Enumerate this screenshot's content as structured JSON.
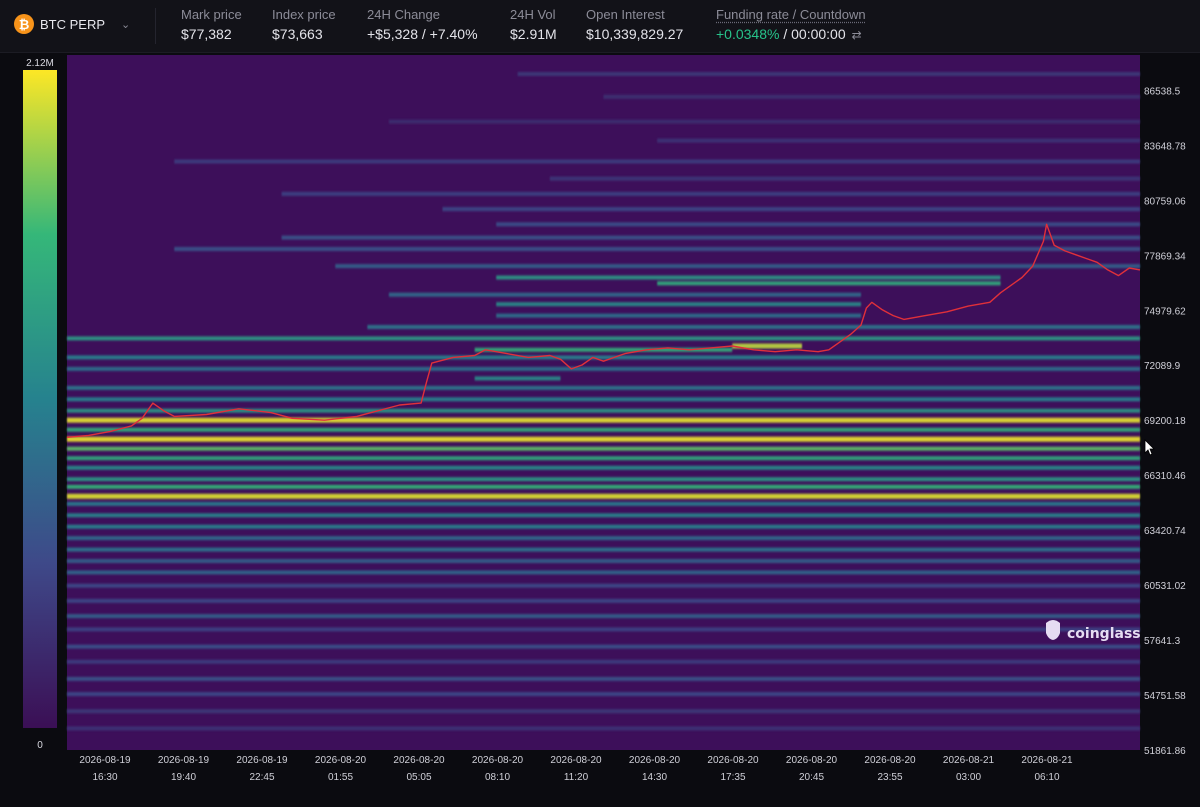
{
  "header": {
    "symbol": "BTC PERP",
    "icon": "bitcoin-icon",
    "stats": [
      {
        "key": "mark",
        "label": "Mark price",
        "value": "$77,382"
      },
      {
        "key": "index",
        "label": "Index price",
        "value": "$73,663"
      },
      {
        "key": "change",
        "label": "24H Change",
        "value": "+$5,328 / +7.40%",
        "color": "#27c28a"
      },
      {
        "key": "vol",
        "label": "24H Vol",
        "value": "$2.91M"
      },
      {
        "key": "oi",
        "label": "Open Interest",
        "value": "$10,339,829.27"
      },
      {
        "key": "funding",
        "label": "Funding rate / Countdown",
        "value_rate": "+0.0348%",
        "value_countdown": " / 00:00:00"
      }
    ]
  },
  "brand": "coinglass",
  "chart_data": {
    "type": "heatmap",
    "title": "",
    "colorbar": {
      "max_label": "2.12M",
      "min_label": "0",
      "colors": [
        "#3b0f55",
        "#3e4989",
        "#26828e",
        "#35b779",
        "#fde725"
      ]
    },
    "y_ticks": [
      "86538.5",
      "83648.78",
      "80759.06",
      "77869.34",
      "74979.62",
      "72089.9",
      "69200.18",
      "66310.46",
      "63420.74",
      "60531.02",
      "57641.3",
      "54751.58",
      "51861.86"
    ],
    "ylim": [
      51861.86,
      88400
    ],
    "x_ticks": [
      {
        "date": "2026-08-19",
        "time": "16:30"
      },
      {
        "date": "2026-08-19",
        "time": "19:40"
      },
      {
        "date": "2026-08-19",
        "time": "22:45"
      },
      {
        "date": "2026-08-20",
        "time": "01:55"
      },
      {
        "date": "2026-08-20",
        "time": "05:05"
      },
      {
        "date": "2026-08-20",
        "time": "08:10"
      },
      {
        "date": "2026-08-20",
        "time": "11:20"
      },
      {
        "date": "2026-08-20",
        "time": "14:30"
      },
      {
        "date": "2026-08-20",
        "time": "17:35"
      },
      {
        "date": "2026-08-20",
        "time": "20:45"
      },
      {
        "date": "2026-08-20",
        "time": "23:55"
      },
      {
        "date": "2026-08-21",
        "time": "03:00"
      },
      {
        "date": "2026-08-21",
        "time": "06:10"
      }
    ],
    "liquidation_levels": [
      {
        "price": 87400,
        "intensity": 0.18,
        "start": 0.42
      },
      {
        "price": 86200,
        "intensity": 0.14,
        "start": 0.5
      },
      {
        "price": 84900,
        "intensity": 0.13,
        "start": 0.3
      },
      {
        "price": 83900,
        "intensity": 0.16,
        "start": 0.55
      },
      {
        "price": 82800,
        "intensity": 0.2,
        "start": 0.1
      },
      {
        "price": 81900,
        "intensity": 0.17,
        "start": 0.45
      },
      {
        "price": 81100,
        "intensity": 0.22,
        "start": 0.2
      },
      {
        "price": 80300,
        "intensity": 0.24,
        "start": 0.35
      },
      {
        "price": 79500,
        "intensity": 0.28,
        "start": 0.4
      },
      {
        "price": 78800,
        "intensity": 0.3,
        "start": 0.2
      },
      {
        "price": 78200,
        "intensity": 0.3,
        "start": 0.1
      },
      {
        "price": 77300,
        "intensity": 0.36,
        "start": 0.25
      },
      {
        "price": 76700,
        "intensity": 0.6,
        "start": 0.4,
        "end": 0.87
      },
      {
        "price": 76400,
        "intensity": 0.7,
        "start": 0.55,
        "end": 0.87
      },
      {
        "price": 75800,
        "intensity": 0.4,
        "start": 0.3,
        "end": 0.74
      },
      {
        "price": 75300,
        "intensity": 0.55,
        "start": 0.4,
        "end": 0.74
      },
      {
        "price": 74700,
        "intensity": 0.42,
        "start": 0.4,
        "end": 0.74
      },
      {
        "price": 74100,
        "intensity": 0.45,
        "start": 0.28
      },
      {
        "price": 73500,
        "intensity": 0.62,
        "start": 0.0
      },
      {
        "price": 73100,
        "intensity": 0.92,
        "start": 0.62,
        "end": 0.685
      },
      {
        "price": 72900,
        "intensity": 0.72,
        "start": 0.38,
        "end": 0.62
      },
      {
        "price": 72500,
        "intensity": 0.5,
        "start": 0.0
      },
      {
        "price": 71900,
        "intensity": 0.42,
        "start": 0.0
      },
      {
        "price": 71400,
        "intensity": 0.55,
        "start": 0.38,
        "end": 0.46
      },
      {
        "price": 70900,
        "intensity": 0.45,
        "start": 0.0
      },
      {
        "price": 70300,
        "intensity": 0.5,
        "start": 0.0
      },
      {
        "price": 69700,
        "intensity": 0.6,
        "start": 0.0
      },
      {
        "price": 69200,
        "intensity": 0.97,
        "start": 0.0
      },
      {
        "price": 68700,
        "intensity": 0.72,
        "start": 0.0
      },
      {
        "price": 68200,
        "intensity": 0.98,
        "start": 0.0
      },
      {
        "price": 67700,
        "intensity": 0.8,
        "start": 0.0
      },
      {
        "price": 67200,
        "intensity": 0.7,
        "start": 0.0
      },
      {
        "price": 66700,
        "intensity": 0.55,
        "start": 0.0
      },
      {
        "price": 66100,
        "intensity": 0.62,
        "start": 0.0
      },
      {
        "price": 65700,
        "intensity": 0.75,
        "start": 0.0
      },
      {
        "price": 65200,
        "intensity": 0.96,
        "start": 0.0
      },
      {
        "price": 64800,
        "intensity": 0.48,
        "start": 0.0
      },
      {
        "price": 64200,
        "intensity": 0.52,
        "start": 0.0
      },
      {
        "price": 63600,
        "intensity": 0.5,
        "start": 0.0
      },
      {
        "price": 63000,
        "intensity": 0.4,
        "start": 0.0
      },
      {
        "price": 62400,
        "intensity": 0.44,
        "start": 0.0
      },
      {
        "price": 61800,
        "intensity": 0.36,
        "start": 0.0
      },
      {
        "price": 61200,
        "intensity": 0.38,
        "start": 0.0
      },
      {
        "price": 60500,
        "intensity": 0.26,
        "start": 0.0
      },
      {
        "price": 59700,
        "intensity": 0.24,
        "start": 0.0
      },
      {
        "price": 58900,
        "intensity": 0.36,
        "start": 0.0
      },
      {
        "price": 58200,
        "intensity": 0.22,
        "start": 0.0
      },
      {
        "price": 57300,
        "intensity": 0.28,
        "start": 0.0
      },
      {
        "price": 56500,
        "intensity": 0.2,
        "start": 0.0
      },
      {
        "price": 55600,
        "intensity": 0.3,
        "start": 0.0
      },
      {
        "price": 54800,
        "intensity": 0.26,
        "start": 0.0
      },
      {
        "price": 53900,
        "intensity": 0.18,
        "start": 0.0
      },
      {
        "price": 53000,
        "intensity": 0.16,
        "start": 0.0
      }
    ],
    "price_series": [
      [
        0.0,
        68300
      ],
      [
        0.02,
        68400
      ],
      [
        0.04,
        68600
      ],
      [
        0.06,
        68900
      ],
      [
        0.07,
        69300
      ],
      [
        0.08,
        70100
      ],
      [
        0.09,
        69700
      ],
      [
        0.1,
        69400
      ],
      [
        0.13,
        69500
      ],
      [
        0.16,
        69800
      ],
      [
        0.19,
        69600
      ],
      [
        0.21,
        69300
      ],
      [
        0.24,
        69200
      ],
      [
        0.27,
        69400
      ],
      [
        0.29,
        69700
      ],
      [
        0.31,
        70000
      ],
      [
        0.33,
        70100
      ],
      [
        0.335,
        71200
      ],
      [
        0.34,
        72200
      ],
      [
        0.36,
        72500
      ],
      [
        0.38,
        72600
      ],
      [
        0.39,
        72900
      ],
      [
        0.41,
        72700
      ],
      [
        0.43,
        72500
      ],
      [
        0.45,
        72600
      ],
      [
        0.46,
        72400
      ],
      [
        0.47,
        71900
      ],
      [
        0.48,
        72100
      ],
      [
        0.49,
        72500
      ],
      [
        0.5,
        72300
      ],
      [
        0.51,
        72500
      ],
      [
        0.52,
        72700
      ],
      [
        0.54,
        72900
      ],
      [
        0.56,
        73000
      ],
      [
        0.58,
        72900
      ],
      [
        0.6,
        73000
      ],
      [
        0.62,
        73100
      ],
      [
        0.64,
        72900
      ],
      [
        0.66,
        72800
      ],
      [
        0.68,
        72900
      ],
      [
        0.7,
        72800
      ],
      [
        0.71,
        72900
      ],
      [
        0.72,
        73300
      ],
      [
        0.73,
        73700
      ],
      [
        0.74,
        74200
      ],
      [
        0.745,
        75100
      ],
      [
        0.75,
        75400
      ],
      [
        0.76,
        75000
      ],
      [
        0.77,
        74700
      ],
      [
        0.78,
        74500
      ],
      [
        0.8,
        74700
      ],
      [
        0.82,
        74900
      ],
      [
        0.84,
        75200
      ],
      [
        0.86,
        75400
      ],
      [
        0.87,
        75900
      ],
      [
        0.88,
        76300
      ],
      [
        0.89,
        76700
      ],
      [
        0.9,
        77300
      ],
      [
        0.91,
        78600
      ],
      [
        0.913,
        79500
      ],
      [
        0.92,
        78400
      ],
      [
        0.93,
        78100
      ],
      [
        0.94,
        77900
      ],
      [
        0.95,
        77700
      ],
      [
        0.96,
        77500
      ],
      [
        0.97,
        77100
      ],
      [
        0.98,
        76800
      ],
      [
        0.99,
        77200
      ],
      [
        1.0,
        77100
      ]
    ]
  }
}
